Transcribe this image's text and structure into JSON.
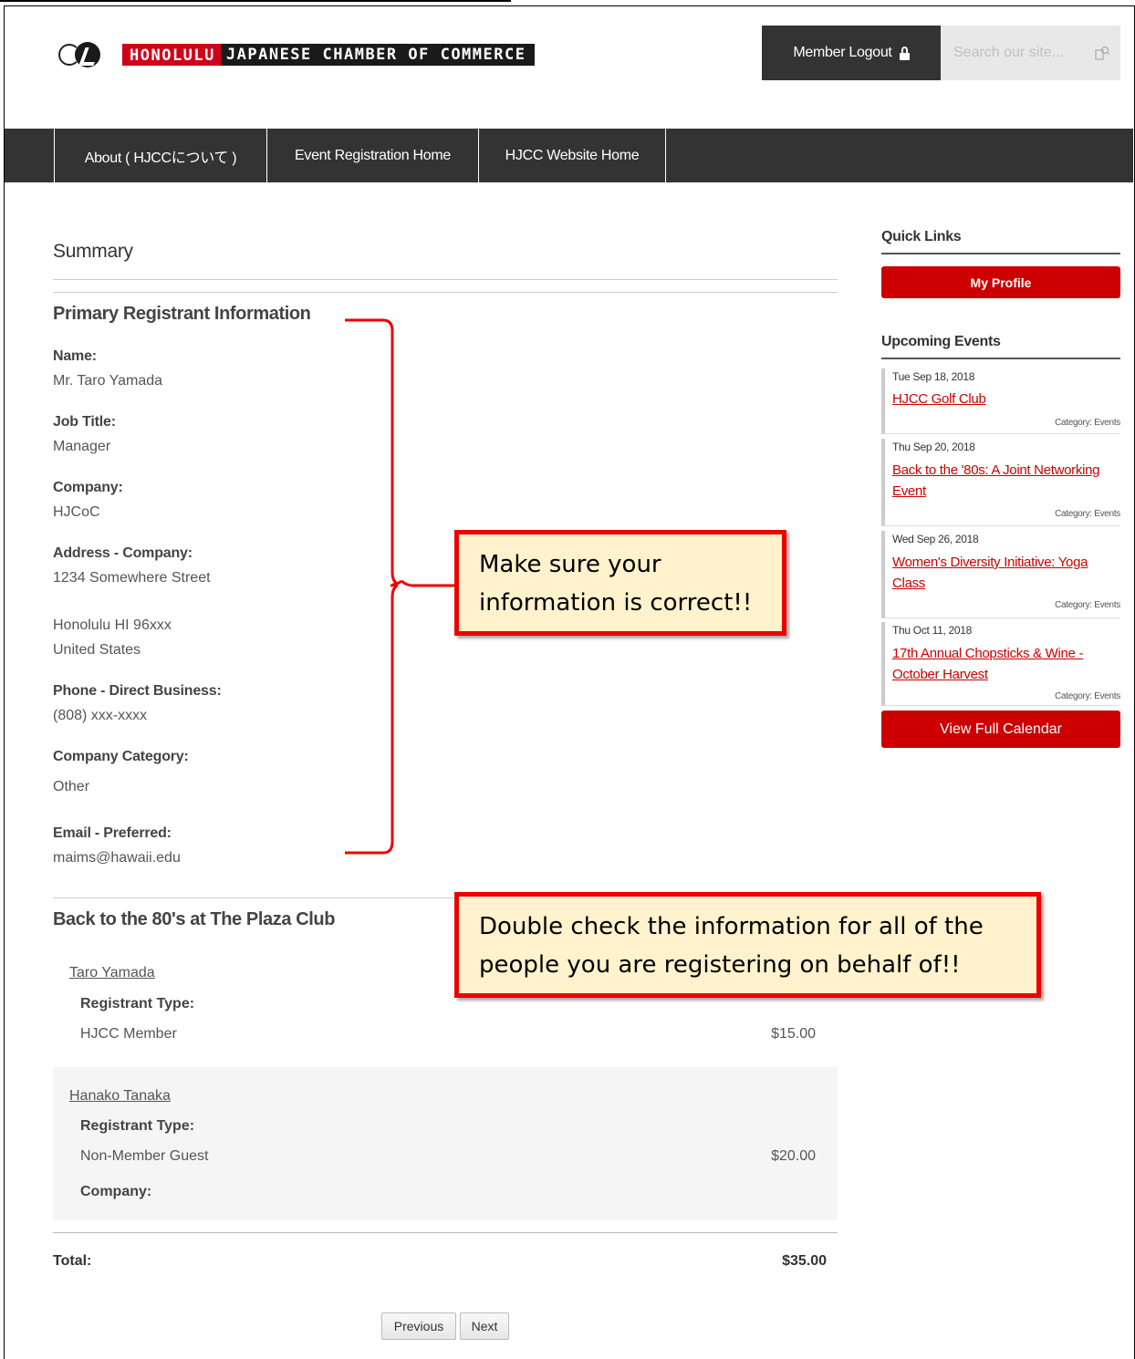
{
  "header": {
    "logo_red": "HONOLULU",
    "logo_rest": "JAPANESE CHAMBER OF COMMERCE",
    "member_logout_label": "Member Logout",
    "search_placeholder": "Search our site..."
  },
  "nav": {
    "items": [
      {
        "label": "About ( HJCCについて )"
      },
      {
        "label": "Event Registration Home"
      },
      {
        "label": "HJCC Website Home"
      }
    ]
  },
  "summary": {
    "title": "Summary",
    "primary_heading": "Primary Registrant Information",
    "fields": [
      {
        "label": "Name:",
        "value": "Mr. Taro Yamada"
      },
      {
        "label": "Job Title:",
        "value": "Manager"
      },
      {
        "label": "Company:",
        "value": "HJCoC"
      },
      {
        "label": "Address - Company:",
        "value": "1234 Somewhere Street",
        "value2": "Honolulu HI 96xxx",
        "value3": "United States"
      },
      {
        "label": "Phone - Direct Business:",
        "value": "(808) xxx-xxxx"
      },
      {
        "label": "Company Category:",
        "value": "Other"
      },
      {
        "label": "Email - Preferred:",
        "value": "maims@hawaii.edu"
      }
    ]
  },
  "event_section": {
    "heading": "Back to the 80's at The Plaza Club",
    "registrants": [
      {
        "name": "Taro Yamada",
        "type_label": "Registrant Type:",
        "type": "HJCC Member",
        "price": "$15.00"
      },
      {
        "name": "Hanako Tanaka",
        "type_label": "Registrant Type:",
        "type": "Non-Member Guest",
        "price": "$20.00",
        "company_label": "Company:"
      }
    ],
    "total_label": "Total:",
    "total_value": "$35.00",
    "previous_label": "Previous",
    "next_label": "Next"
  },
  "sidebar": {
    "quick_links_title": "Quick Links",
    "my_profile_label": "My Profile",
    "upcoming_title": "Upcoming Events",
    "events": [
      {
        "date": "Tue Sep 18, 2018",
        "title": "HJCC Golf Club",
        "category": "Category: Events"
      },
      {
        "date": "Thu Sep 20, 2018",
        "title": "Back to the '80s: A Joint Networking Event",
        "category": "Category: Events"
      },
      {
        "date": "Wed Sep 26, 2018",
        "title": "Women's Diversity Initiative: Yoga Class",
        "category": "Category: Events"
      },
      {
        "date": "Thu Oct 11, 2018",
        "title": "17th Annual Chopsticks & Wine - October Harvest",
        "category": "Category: Events"
      }
    ],
    "view_calendar_label": "View Full Calendar"
  },
  "annotations": {
    "callout1": "Make sure your information is correct!!",
    "callout2": "Double check the information for all of the people you are registering on behalf of!!"
  },
  "colors": {
    "accent_red": "#cc0000",
    "nav_dark": "#333333",
    "callout_fill": "#fff2cc"
  }
}
